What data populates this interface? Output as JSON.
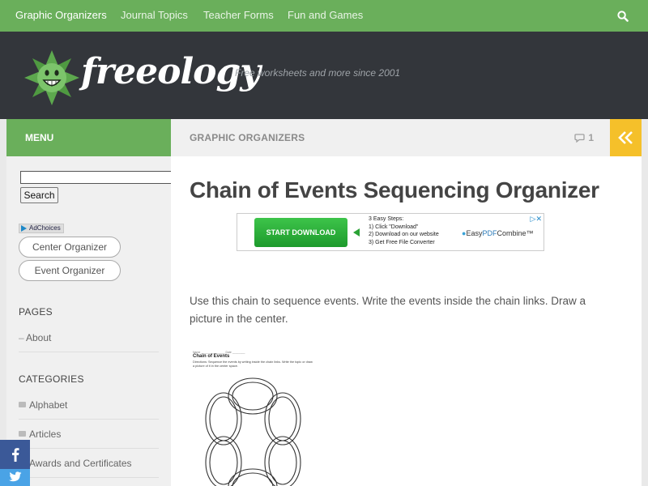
{
  "nav": {
    "items": [
      "Graphic Organizers",
      "Journal Topics",
      "Teacher Forms",
      "Fun and Games"
    ],
    "active_index": 0,
    "search_icon": "search-icon"
  },
  "header": {
    "logo_text": "freeology",
    "tagline": "Free worksheets and more since 2001"
  },
  "menu_label": "MENU",
  "breadcrumb": "GRAPHIC ORGANIZERS",
  "comment_count": "1",
  "sidebar": {
    "search_button": "Search",
    "adchoices": "AdChoices",
    "ad_pills": [
      "Center Organizer",
      "Event Organizer"
    ],
    "pages_title": "PAGES",
    "pages": [
      "About"
    ],
    "categories_title": "CATEGORIES",
    "categories": [
      "Alphabet",
      "Articles",
      "Awards and Certificates"
    ]
  },
  "main": {
    "title": "Chain of Events Sequencing Organizer",
    "ad": {
      "button": "START DOWNLOAD",
      "steps_header": "3 Easy Steps:",
      "steps": [
        "1) Click \"Download\"",
        "2) Download on our website",
        "3) Get Free File Converter"
      ],
      "brand_prefix": "Easy",
      "brand_pdf": "PDF",
      "brand_suffix": "Combine",
      "brand_tm": "™"
    },
    "paragraph": "Use this chain to sequence events. Write the events inside the chain links. Draw a picture in the center.",
    "worksheet": {
      "meta": "Name _______________          Date ________",
      "title": "Chain of Events",
      "directions": "Directions: Sequence the events by writing inside the chain links. Write the topic or draw a picture of it in the center space."
    }
  },
  "colors": {
    "green": "#6aaf5b",
    "dark_header": "#33363b",
    "yellow": "#f5c02a",
    "facebook": "#3b5998",
    "twitter": "#4aa3e6"
  }
}
